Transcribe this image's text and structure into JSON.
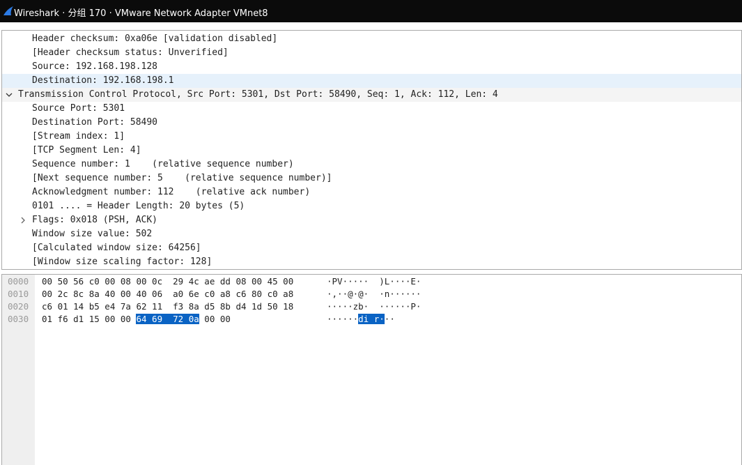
{
  "window": {
    "title": "Wireshark · 分组 170 · VMware Network Adapter VMnet8",
    "icon": "wireshark-fin-icon"
  },
  "details": {
    "ip_rows": [
      "Header checksum: 0xa06e [validation disabled]",
      "[Header checksum status: Unverified]",
      "Source: 192.168.198.128",
      "Destination: 192.168.198.1"
    ],
    "tcp_header": "Transmission Control Protocol, Src Port: 5301, Dst Port: 58490, Seq: 1, Ack: 112, Len: 4",
    "tcp_rows": [
      "Source Port: 5301",
      "Destination Port: 58490",
      "[Stream index: 1]",
      "[TCP Segment Len: 4]",
      "Sequence number: 1    (relative sequence number)",
      "[Next sequence number: 5    (relative sequence number)]",
      "Acknowledgment number: 112    (relative ack number)",
      "0101 .... = Header Length: 20 bytes (5)",
      "Flags: 0x018 (PSH, ACK)",
      "Window size value: 502",
      "[Calculated window size: 64256]",
      "[Window size scaling factor: 128]"
    ]
  },
  "bytes": {
    "rows": [
      {
        "offset": "0000",
        "hex": "00 50 56 c0 00 08 00 0c  29 4c ae dd 08 00 45 00",
        "ascii": "·PV·····  )L····E·"
      },
      {
        "offset": "0010",
        "hex": "00 2c 8c 8a 40 00 40 06  a0 6e c0 a8 c6 80 c0 a8",
        "ascii": "·,··@·@·  ·n······"
      },
      {
        "offset": "0020",
        "hex": "c6 01 14 b5 e4 7a 62 11  f3 8a d5 8b d4 1d 50 18",
        "ascii": "·····zb·  ······P·"
      },
      {
        "offset": "0030",
        "hex_pre": "01 f6 d1 15 00 00 ",
        "hex_sel": "64 69  72 0a",
        "hex_post": " 00 00",
        "ascii_pre": "······",
        "ascii_sel": "di r·",
        "ascii_post": "··"
      }
    ]
  },
  "colors": {
    "selection": "#0a63c4",
    "row_highlight": "#e6f1fb",
    "titlebar": "#0b0b0b"
  }
}
